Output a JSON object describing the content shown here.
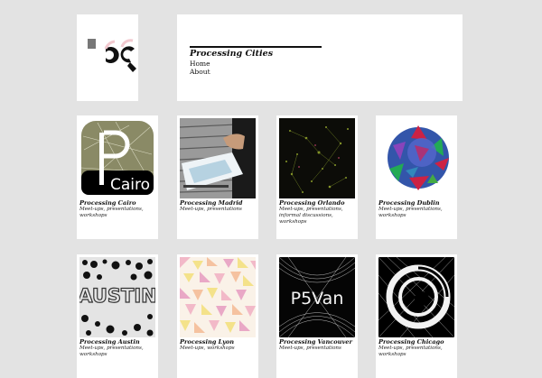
{
  "site": {
    "title": "Processing Cities",
    "nav": [
      "Home",
      "About"
    ]
  },
  "cities": [
    {
      "title": "Processing Cairo",
      "desc": "Meet-ups, presentations, workshops",
      "thumb": "cairo-logo",
      "thumb_text": "Cairo"
    },
    {
      "title": "Processing Madrid",
      "desc": "Meet-ups, presentations",
      "thumb": "madrid-photo"
    },
    {
      "title": "Processing Orlando",
      "desc": "Meet-ups, presentations, informal discussions, workshops",
      "thumb": "orlando-particles"
    },
    {
      "title": "Processing Dublin",
      "desc": "Meet-ups, presentations, workshops",
      "thumb": "dublin-sphere"
    },
    {
      "title": "Processing Austin",
      "desc": "Meet-ups, presentations, workshops",
      "thumb": "austin-dots",
      "thumb_text": "AUSTIN"
    },
    {
      "title": "Processing Lyon",
      "desc": "Meet-ups, workshops",
      "thumb": "lyon-triangles"
    },
    {
      "title": "Processing Vancouver",
      "desc": "Meet-ups, presentations",
      "thumb": "vancouver-logo",
      "thumb_text": "P5Van"
    },
    {
      "title": "Processing Chicago",
      "desc": "Meet-ups, presentations, workshops",
      "thumb": "chicago-lines"
    }
  ],
  "colors": {
    "page_bg": "#e3e3e3",
    "card_bg": "#ffffff",
    "text": "#111111"
  }
}
